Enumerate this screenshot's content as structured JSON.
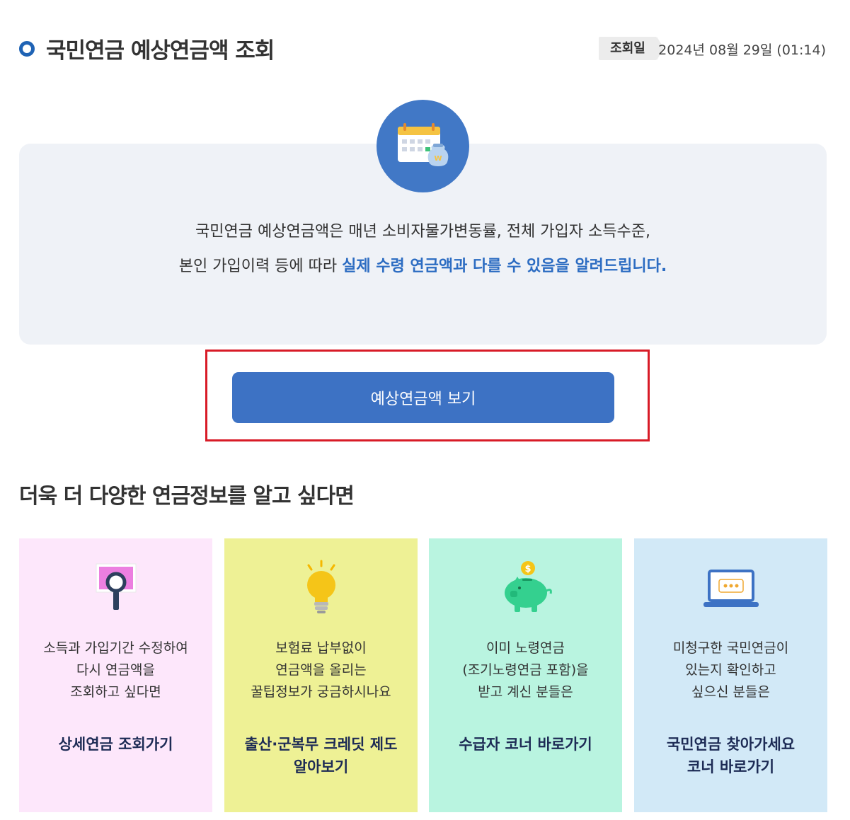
{
  "header": {
    "title": "국민연금 예상연금액 조회",
    "date_label": "조회일",
    "date_value": "2024년 08월 29일 (01:14)"
  },
  "notice": {
    "icon": "calendar-money-icon",
    "line1": "국민연금 예상연금액은 매년 소비자물가변동률, 전체 가입자 소득수준,",
    "line2_plain": "본인 가입이력 등에 따라 ",
    "line2_emphasis": "실제 수령 연금액과 다를 수 있음을 알려드립니다."
  },
  "view_button_label": "예상연금액 보기",
  "more_section": {
    "title": "더욱 더 다양한 연금정보를 알고 싶다면",
    "cards": [
      {
        "icon": "magnifier-icon",
        "bg": "#fde7fb",
        "desc": [
          "소득과 가입기간 수정하여",
          "다시 연금액을",
          "조회하고 싶다면"
        ],
        "link": [
          "상세연금 조회가기"
        ]
      },
      {
        "icon": "lightbulb-icon",
        "bg": "#eef195",
        "desc": [
          "보험료 납부없이",
          "연금액을 올리는",
          "꿀팁정보가 궁금하시나요"
        ],
        "link": [
          "출산·군복무 크레딧 제도",
          "알아보기"
        ]
      },
      {
        "icon": "piggy-bank-icon",
        "bg": "#b9f4e0",
        "desc": [
          "이미 노령연금",
          "(조기노령연금 포함)을",
          "받고 계신 분들은"
        ],
        "link": [
          "수급자 코너 바로가기"
        ]
      },
      {
        "icon": "laptop-icon",
        "bg": "#d2e9f7",
        "desc": [
          "미청구한 국민연금이",
          "있는지 확인하고",
          "싶으신 분들은"
        ],
        "link": [
          "국민연금 찾아가세요",
          "코너 바로가기"
        ]
      }
    ]
  }
}
